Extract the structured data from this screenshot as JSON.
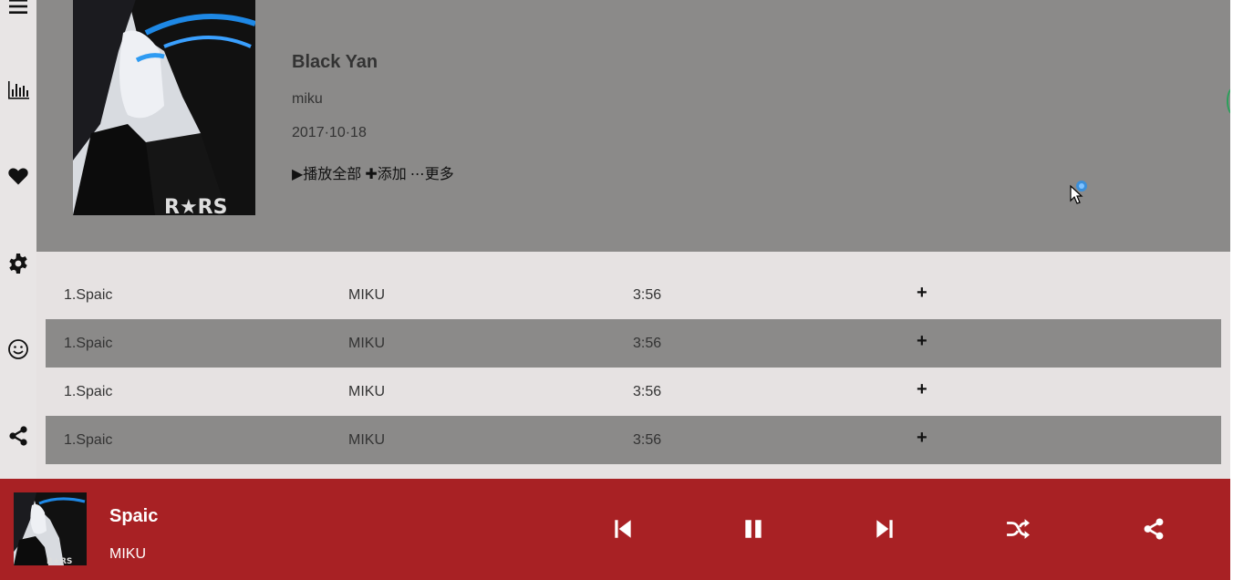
{
  "sidebar": {
    "items": [
      {
        "icon": "menu-icon"
      },
      {
        "icon": "chart-icon"
      },
      {
        "icon": "heart-icon"
      },
      {
        "icon": "gear-icon"
      },
      {
        "icon": "smile-icon"
      },
      {
        "icon": "share-icon"
      }
    ]
  },
  "album": {
    "title": "Black Yan",
    "artist": "miku",
    "date": "2017·10·18",
    "actions": {
      "play_all": "▶播放全部",
      "add": "✚添加",
      "more": "⋯更多"
    }
  },
  "tracks": [
    {
      "name": "1.Spaic",
      "artist": "MIKU",
      "duration": "3:56",
      "add": "+"
    },
    {
      "name": "1.Spaic",
      "artist": "MIKU",
      "duration": "3:56",
      "add": "+"
    },
    {
      "name": "1.Spaic",
      "artist": "MIKU",
      "duration": "3:56",
      "add": "+"
    },
    {
      "name": "1.Spaic",
      "artist": "MIKU",
      "duration": "3:56",
      "add": "+"
    }
  ],
  "player": {
    "title": "Spaic",
    "artist": "MIKU",
    "controls": [
      "previous-icon",
      "pause-icon",
      "next-icon",
      "shuffle-icon",
      "share-icon"
    ]
  },
  "colors": {
    "header_bg": "#8b8a89",
    "player_bg": "#a82124",
    "list_bg": "#e6e2e2"
  }
}
